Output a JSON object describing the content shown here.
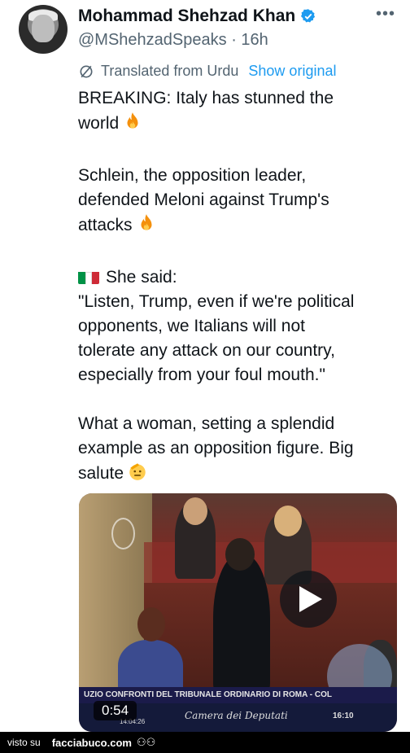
{
  "author": {
    "name": "Mohammad Shehzad Khan",
    "handle": "@MShehzadSpeaks",
    "time": "· 16h"
  },
  "translation": {
    "label": "Translated from Urdu",
    "show_original": "Show original"
  },
  "tweet": {
    "line1": "BREAKING: Italy has stunned the",
    "line2": "world",
    "para2_line1": "Schlein, the opposition leader,",
    "para2_line2": "defended Meloni against Trump's",
    "para2_line3": "attacks",
    "said": "She said:",
    "quote1": "\"Listen, Trump, even if we're political",
    "quote2": "opponents, we Italians will not",
    "quote3": "tolerate any attack on our country,",
    "quote4": "especially from your foul mouth.\"",
    "closing1": "What a woman, setting a splendid",
    "closing2": "example as an opposition figure. Big",
    "closing3": "salute"
  },
  "video": {
    "duration": "0:54",
    "ticker": "UZIO    CONFRONTI DEL TRIBUNALE ORDINARIO DI ROMA - COL",
    "channel": "Camera dei Deputati",
    "clock_left": "14:04:26",
    "clock_right": "16:10"
  },
  "footer": {
    "visto": "visto su",
    "site": "facciabuco.com"
  },
  "colors": {
    "accent": "#1d9bf0",
    "secondary_text": "#536471"
  }
}
